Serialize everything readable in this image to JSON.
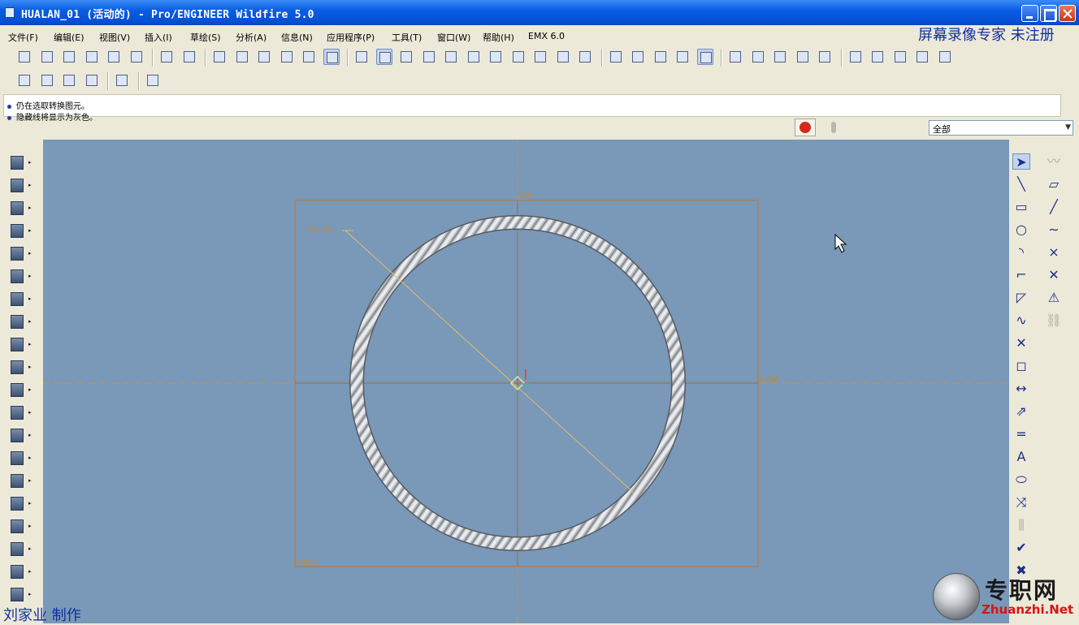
{
  "window": {
    "title": "HUALAN_01 (活动的) - Pro/ENGINEER Wildfire 5.0",
    "titlebar_color": "#0a5ee3"
  },
  "menu": [
    {
      "label": "文件(F)"
    },
    {
      "label": "编辑(E)"
    },
    {
      "label": "视图(V)"
    },
    {
      "label": "插入(I)"
    },
    {
      "label": "草绘(S)"
    },
    {
      "label": "分析(A)"
    },
    {
      "label": "信息(N)"
    },
    {
      "label": "应用程序(P)"
    },
    {
      "label": "工具(T)"
    },
    {
      "label": "窗口(W)"
    },
    {
      "label": "帮助(H)"
    },
    {
      "label": "EMX 6.0"
    }
  ],
  "overlay": {
    "recorder_text": "屏幕录像专家  未注册",
    "author_text": "刘家业 制作"
  },
  "messages": [
    "仍在选取转换图元。",
    "隐藏线将显示为灰色。"
  ],
  "filter": {
    "value": "全部"
  },
  "toolbar": {
    "row1": [
      "new-file-icon",
      "open-file-icon",
      "save-icon",
      "print-icon",
      "send-mail-icon",
      "send-mail-alt-icon",
      "undo-icon",
      "redo-icon",
      "cut-icon",
      "copy-icon",
      "paste-icon",
      "paste-special-icon",
      "regenerate-icon",
      "select-box-icon",
      "sketch-orient-icon",
      "sketch-entity-icon",
      "layers-icon",
      "shade-sphere-icon",
      "zoom-in-icon",
      "zoom-out-icon",
      "refit-icon",
      "reorient-icon",
      "saved-views-icon",
      "layer-icon",
      "model-tree-icon",
      "wireframe-icon",
      "hidden-line-icon",
      "no-hidden-icon",
      "shading-icon",
      "spin-center-icon",
      "datum-planes-icon",
      "datum-axes-icon",
      "datum-points-icon",
      "csys-icon",
      "annotation-icon",
      "sketch-setup-icon",
      "toggle-dims-icon",
      "toggle-constraints-icon",
      "toggle-grid-icon",
      "toggle-vertices-icon"
    ],
    "row2": [
      "select-chain-icon",
      "select-region-icon",
      "select-intersect-icon",
      "select-filter-icon",
      "sketcher-display-icon",
      "context-help-icon"
    ]
  },
  "left_toolbar": [
    "extrude-icon",
    "revolve-icon",
    "variable-sweep-icon",
    "blend-icon",
    "datum-plane-icon",
    "datum-axis-icon",
    "sketch-tool-icon",
    "hole-icon",
    "shell-icon",
    "rib-icon",
    "draft-icon",
    "round-icon",
    "chamfer-icon",
    "pattern-icon",
    "mirror-icon",
    "merge-icon",
    "trim-icon",
    "offset-icon",
    "thicken-icon",
    "solidify-icon"
  ],
  "right_toolbar": [
    "select-arrow-icon",
    "line-icon",
    "rectangle-icon",
    "circle-icon",
    "arc-icon",
    "fillet-icon",
    "chamfer-sketch-icon",
    "spline-icon",
    "point-icon",
    "use-edge-icon",
    "dimension-icon",
    "modify-icon",
    "constraint-icon",
    "text-icon",
    "palette-icon",
    "trim-sketch-icon",
    "mirror-sketch-icon",
    "done-check-icon",
    "cancel-x-icon"
  ],
  "viewport": {
    "background": "#7a98b8",
    "labels": {
      "top": "TOP",
      "right": "RIGHT",
      "dtm": "DTM27",
      "dimension": "60.00"
    }
  },
  "watermark": {
    "cn": "专职网",
    "en": "Zhuanzhi.Net"
  }
}
